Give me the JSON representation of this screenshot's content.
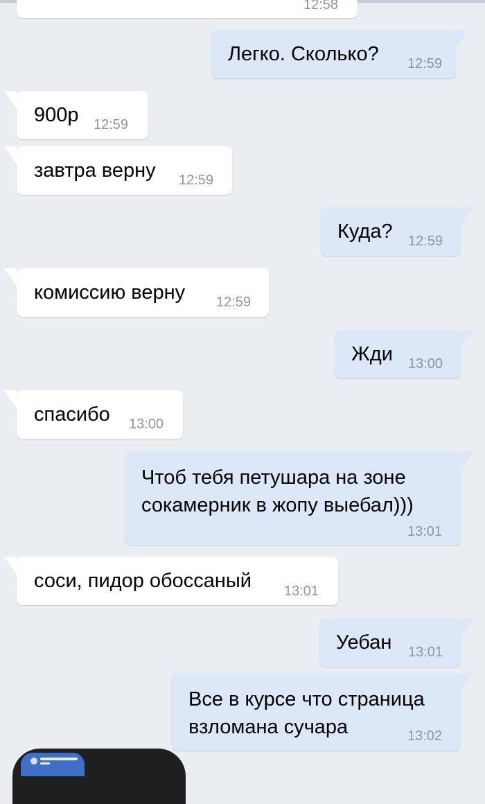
{
  "colors": {
    "background": "#eaeef3",
    "incoming_bubble": "#ffffff",
    "outgoing_bubble": "#dce8f8",
    "time_text": "#8c95a0"
  },
  "messages": [
    {
      "direction": "in",
      "text": "",
      "time": "12:58"
    },
    {
      "direction": "out",
      "text": "Легко. Сколько?",
      "time": "12:59"
    },
    {
      "direction": "in",
      "text": "900р",
      "time": "12:59"
    },
    {
      "direction": "in",
      "text": "завтра верну",
      "time": "12:59"
    },
    {
      "direction": "out",
      "text": "Куда?",
      "time": "12:59"
    },
    {
      "direction": "in",
      "text": "комиссию верну",
      "time": "12:59"
    },
    {
      "direction": "out",
      "text": "Жди",
      "time": "13:00"
    },
    {
      "direction": "in",
      "text": "спасибо",
      "time": "13:00"
    },
    {
      "direction": "out",
      "text": "Чтоб тебя петушара на зоне сокамерник в жопу выебал)))",
      "time": "13:01"
    },
    {
      "direction": "in",
      "text": "соси, пидор обоссаный",
      "time": "13:01"
    },
    {
      "direction": "out",
      "text": "Уебан",
      "time": "13:01"
    },
    {
      "direction": "out",
      "text": "Все в курсе что страница взломана сучара",
      "time": "13:02"
    }
  ]
}
